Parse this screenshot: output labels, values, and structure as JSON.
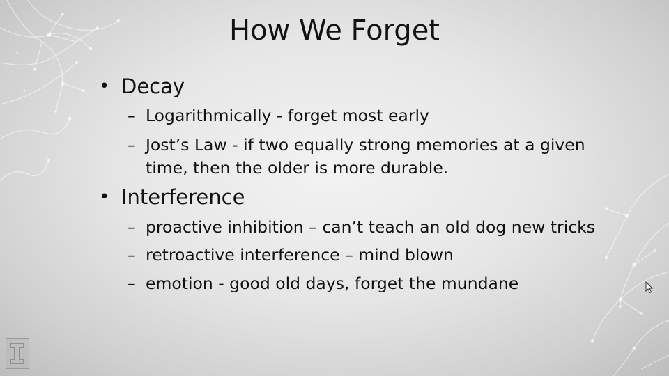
{
  "slide": {
    "title": "How We Forget",
    "sections": [
      {
        "heading": "Decay",
        "items": [
          "Logarithmically - forget most early",
          "Jost’s Law - if two equally strong memories at a given time, then the older is more durable."
        ]
      },
      {
        "heading": "Interference",
        "items": [
          "proactive inhibition – can’t teach an old dog new tricks",
          "retroactive interference – mind blown",
          "emotion - good old days, forget the mundane"
        ]
      }
    ],
    "bullet_glyph": "•",
    "dash_glyph": "–"
  },
  "icons": {
    "logo": "block-i-logo-icon",
    "cursor": "mouse-pointer-icon"
  },
  "colors": {
    "text": "#121212",
    "background_center": "#f3f3f3",
    "background_edge": "#bdbdbd"
  }
}
